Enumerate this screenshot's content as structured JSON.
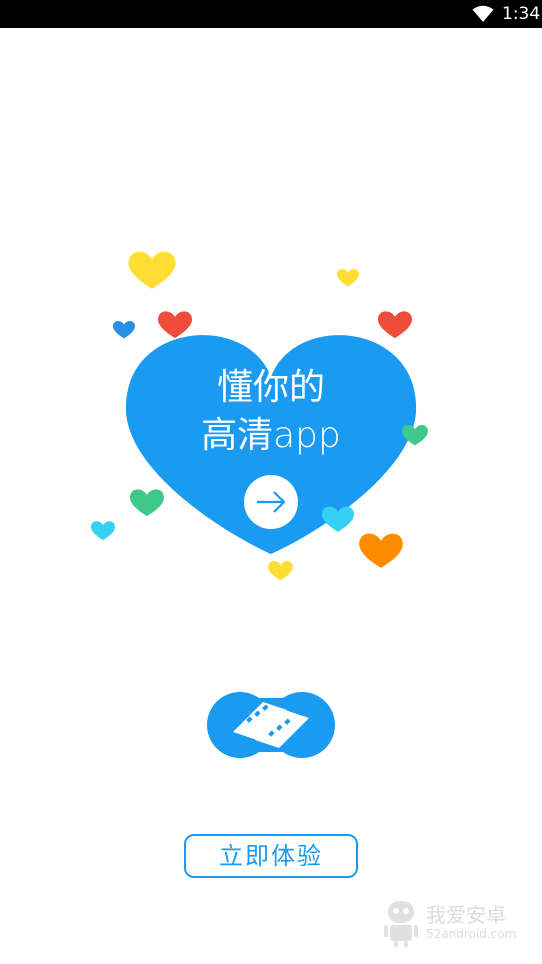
{
  "status_bar": {
    "time": "1:34",
    "wifi_icon": "wifi-icon"
  },
  "hero": {
    "slogan_line1": "懂你的",
    "slogan_line2": "高清app",
    "heart_color": "#1a9af0",
    "arrow_icon": "arrow-right-icon"
  },
  "decor_colors": {
    "yellow": "#ffdd33",
    "red": "#ef4d3c",
    "blue": "#2a8ee8",
    "green": "#3ec98b",
    "cyan": "#36d0f3",
    "orange": "#ff8c00"
  },
  "logo": {
    "icon": "infinity-film-logo-icon",
    "color": "#1a9af0"
  },
  "cta": {
    "label": "立即体验"
  },
  "watermark": {
    "title": "我爱安卓",
    "subtitle": "52android.com",
    "icon": "android-robot-icon"
  }
}
